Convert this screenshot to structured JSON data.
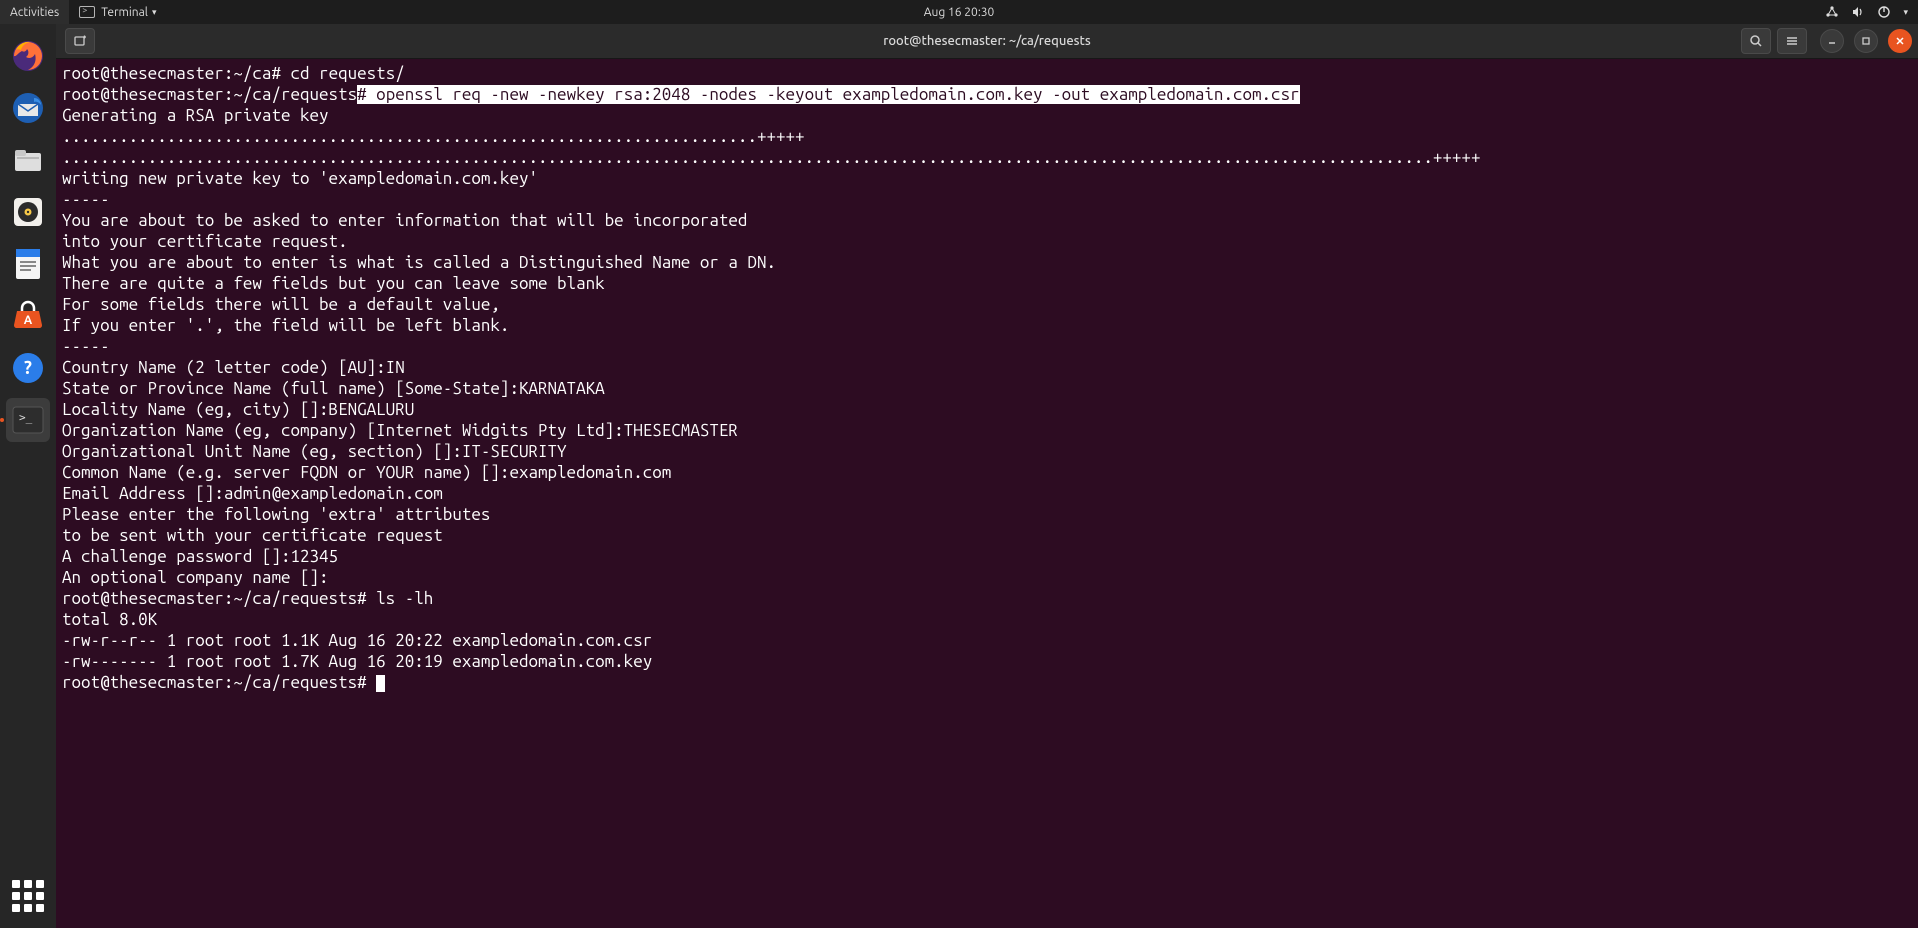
{
  "panel": {
    "activities": "Activities",
    "app_label": "Terminal",
    "datetime": "Aug 16  20:30"
  },
  "dock": {
    "items": [
      {
        "name": "firefox",
        "semantic": "firefox-icon"
      },
      {
        "name": "thunderbird",
        "semantic": "thunderbird-icon"
      },
      {
        "name": "files",
        "semantic": "files-icon"
      },
      {
        "name": "rhythmbox",
        "semantic": "rhythmbox-icon"
      },
      {
        "name": "writer",
        "semantic": "writer-icon"
      },
      {
        "name": "software",
        "semantic": "software-icon"
      },
      {
        "name": "help",
        "semantic": "help-icon"
      },
      {
        "name": "terminal",
        "semantic": "terminal-icon",
        "active": true
      }
    ]
  },
  "window": {
    "title": "root@thesecmaster: ~/ca/requests"
  },
  "terminal": {
    "prompt1": "root@thesecmaster:~/ca#",
    "cmd1": " cd requests/",
    "prompt2": "root@thesecmaster:~/ca/requests",
    "hash2": "#",
    "cmd2_sel": " openssl req -new -newkey rsa:2048 -nodes -keyout exampledomain.com.key -out exampledomain.com.csr",
    "lines_b": [
      "Generating a RSA private key",
      ".........................................................................+++++",
      "................................................................................................................................................+++++",
      "writing new private key to 'exampledomain.com.key'",
      "-----",
      "You are about to be asked to enter information that will be incorporated",
      "into your certificate request.",
      "What you are about to enter is what is called a Distinguished Name or a DN.",
      "There are quite a few fields but you can leave some blank",
      "For some fields there will be a default value,",
      "If you enter '.', the field will be left blank.",
      "-----",
      "Country Name (2 letter code) [AU]:IN",
      "State or Province Name (full name) [Some-State]:KARNATAKA",
      "Locality Name (eg, city) []:BENGALURU",
      "Organization Name (eg, company) [Internet Widgits Pty Ltd]:THESECMASTER",
      "Organizational Unit Name (eg, section) []:IT-SECURITY",
      "Common Name (e.g. server FQDN or YOUR name) []:exampledomain.com",
      "Email Address []:admin@exampledomain.com",
      "",
      "Please enter the following 'extra' attributes",
      "to be sent with your certificate request",
      "A challenge password []:12345",
      "An optional company name []:"
    ],
    "prompt3": "root@thesecmaster:~/ca/requests#",
    "cmd3": " ls -lh",
    "lines_c": [
      "total 8.0K",
      "-rw-r--r-- 1 root root 1.1K Aug 16 20:22 exampledomain.com.csr",
      "-rw------- 1 root root 1.7K Aug 16 20:19 exampledomain.com.key"
    ],
    "prompt4": "root@thesecmaster:~/ca/requests# "
  }
}
